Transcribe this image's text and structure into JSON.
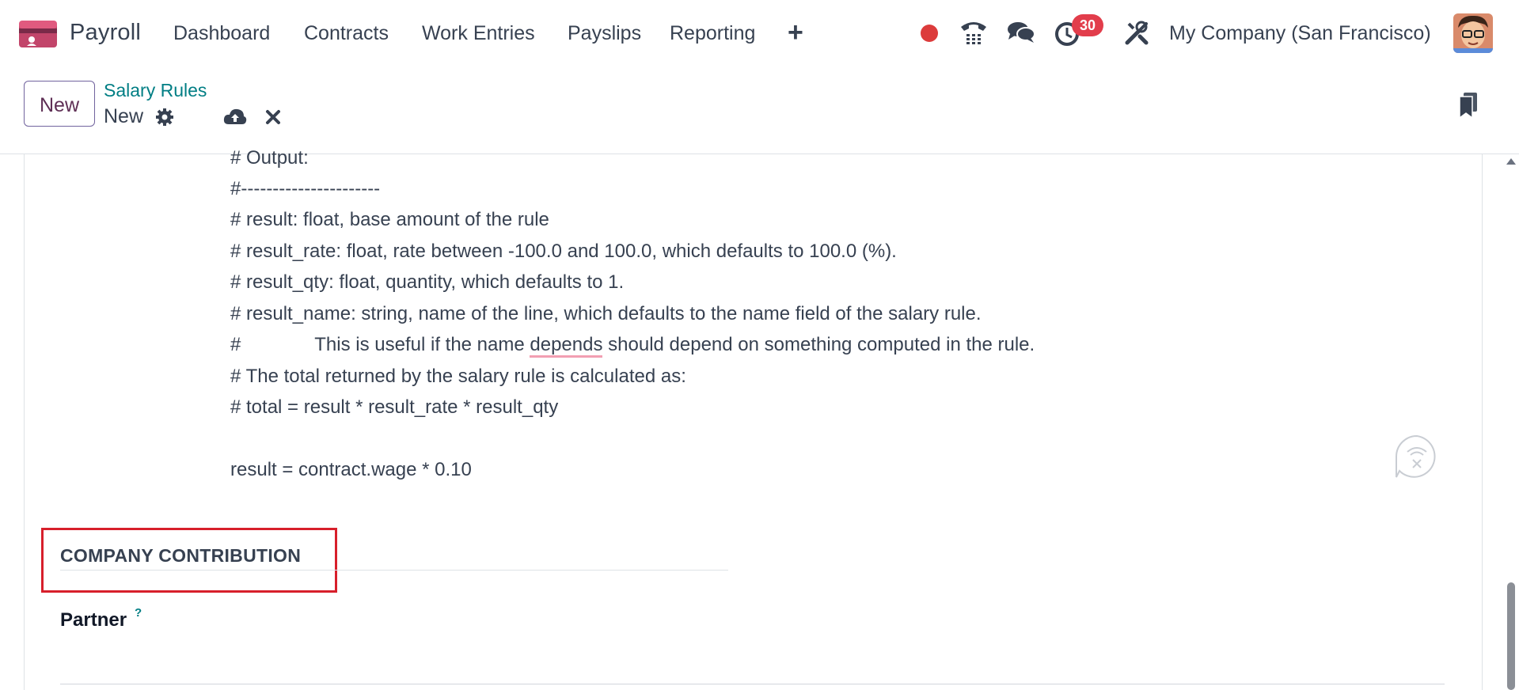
{
  "navbar": {
    "app_name": "Payroll",
    "app_icon": "payroll-app-icon",
    "menu": [
      {
        "label": "Dashboard"
      },
      {
        "label": "Contracts"
      },
      {
        "label": "Work Entries"
      },
      {
        "label": "Payslips"
      },
      {
        "label": "Reporting"
      }
    ],
    "plus_icon": "+",
    "notification_count": "30",
    "company": "My Company (San Francisco)",
    "icons": [
      "record-dot-icon",
      "phone-icon",
      "chat-icon",
      "activity-clock-icon",
      "debug-tools-icon",
      "user-avatar"
    ]
  },
  "control_panel": {
    "new_button": "New",
    "breadcrumb": "Salary Rules",
    "record_name": "New",
    "icons": [
      "gear-icon",
      "save-cloud-icon",
      "discard-icon",
      "bookmark-icon"
    ]
  },
  "code": {
    "lines": [
      "# Output:",
      "#----------------------",
      "# result: float, base amount of the rule",
      "# result_rate: float, rate between -100.0 and 100.0, which defaults to 100.0 (%).",
      "# result_qty: float, quantity, which defaults to 1.",
      "# result_name: string, name of the line, which defaults to the name field of the salary rule.",
      "#              This is useful if the name ",
      "depends",
      " should depend on something computed in the rule.",
      "# The total returned by the salary rule is calculated as:",
      "# total = result * result_rate * result_qty",
      "",
      "result = contract.wage * 0.10"
    ]
  },
  "section": {
    "title": "COMPANY CONTRIBUTION",
    "highlight_color": "#d71f2b",
    "partner_label": "Partner",
    "help_mark": "?"
  },
  "colors": {
    "accent_teal": "#017e84",
    "brand_purple": "#5f2f55",
    "badge_red": "#e23d4b"
  }
}
